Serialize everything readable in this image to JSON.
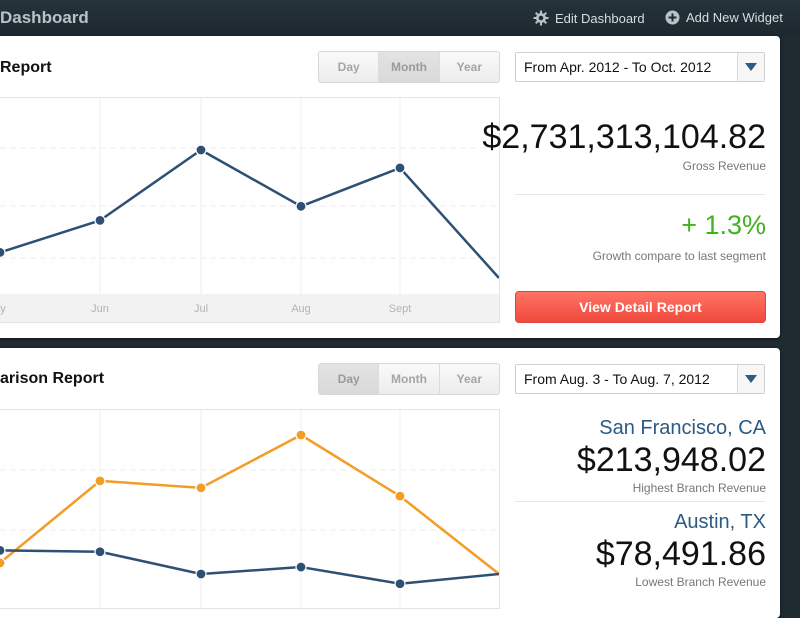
{
  "header": {
    "title": "Dashboard",
    "edit_label": "Edit Dashboard",
    "add_label": "Add New Widget"
  },
  "revenue_panel": {
    "title": "Report",
    "ranges": [
      "Day",
      "Month",
      "Year"
    ],
    "active_range": "Month",
    "date_range": "From Apr. 2012 - To Oct. 2012",
    "gross_revenue": "$2,731,313,104.82",
    "gross_label": "Gross Revenue",
    "growth": "+ 1.3%",
    "growth_label": "Growth compare to last segment",
    "detail_button": "View Detail Report"
  },
  "comparison_panel": {
    "title": "arison Report",
    "ranges": [
      "Day",
      "Month",
      "Year"
    ],
    "active_range": "Day",
    "date_range": "From Aug. 3 - To Aug. 7, 2012",
    "highest_city": "San Francisco, CA",
    "highest_value": "$213,948.02",
    "highest_label": "Highest Branch Revenue",
    "lowest_city": "Austin, TX",
    "lowest_value": "$78,491.86",
    "lowest_label": "Lowest Branch Revenue"
  },
  "colors": {
    "navy": "#2d5074",
    "orange": "#f39c26",
    "green": "#3fb31e",
    "red": "#f0493c"
  },
  "chart_data": [
    {
      "type": "line",
      "categories": [
        "ay",
        "Jun",
        "Jul",
        "Aug",
        "Sept",
        ""
      ],
      "series": [
        {
          "values": [
            0.2,
            0.45,
            1.0,
            0.56,
            0.86,
            0.0
          ]
        }
      ],
      "grid": true
    },
    {
      "type": "line",
      "categories": [
        "",
        "",
        "",
        "",
        "",
        ""
      ],
      "series": [
        {
          "values": [
            0.08,
            0.67,
            0.62,
            1.0,
            0.56,
            0.0
          ]
        },
        {
          "values": [
            0.17,
            0.16,
            0.0,
            0.05,
            -0.07,
            0.0
          ]
        }
      ],
      "grid": true
    }
  ]
}
